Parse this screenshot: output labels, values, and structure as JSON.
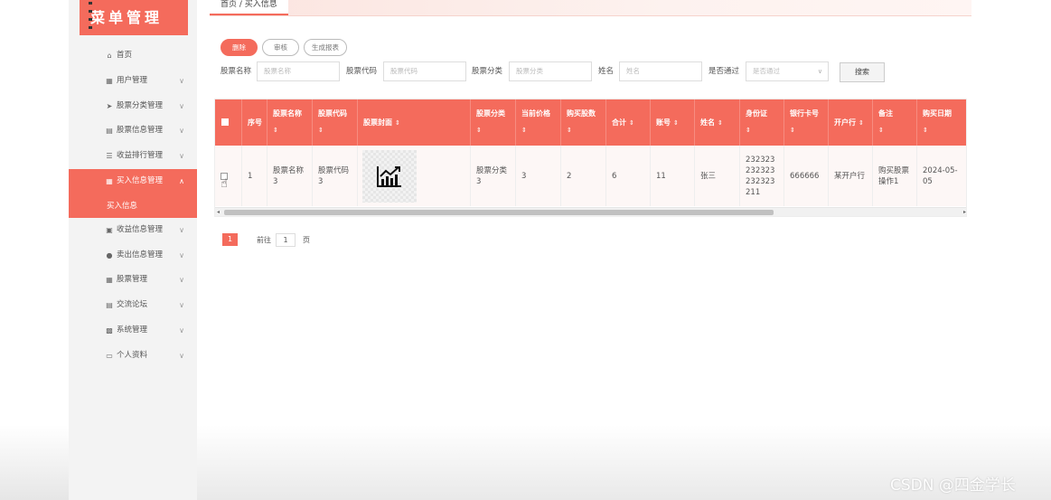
{
  "app": {
    "logo_text": "菜单管理",
    "watermark": "CSDN @四金学长"
  },
  "colors": {
    "accent": "#f46b5c",
    "sidebar_bg": "#f3f3f3"
  },
  "sidebar": {
    "items": [
      {
        "icon": "home-icon",
        "glyph": "⌂",
        "label": "首页",
        "chevron": false
      },
      {
        "icon": "grid-icon",
        "glyph": "▦",
        "label": "用户管理",
        "chevron": true
      },
      {
        "icon": "send-icon",
        "glyph": "➤",
        "label": "股票分类管理",
        "chevron": true
      },
      {
        "icon": "document-icon",
        "glyph": "▤",
        "label": "股票信息管理",
        "chevron": true
      },
      {
        "icon": "list-icon",
        "glyph": "☰",
        "label": "收益排行管理",
        "chevron": true
      },
      {
        "icon": "grid-icon",
        "glyph": "▦",
        "label": "买入信息管理",
        "chevron": true,
        "active": true,
        "sub": "买入信息"
      },
      {
        "icon": "chart-icon",
        "glyph": "▣",
        "label": "收益信息管理",
        "chevron": true
      },
      {
        "icon": "user-icon",
        "glyph": "●",
        "label": "卖出信息管理",
        "chevron": true
      },
      {
        "icon": "grid-icon",
        "glyph": "▦",
        "label": "股票管理",
        "chevron": true
      },
      {
        "icon": "message-icon",
        "glyph": "▤",
        "label": "交流论坛",
        "chevron": true
      },
      {
        "icon": "briefcase-icon",
        "glyph": "▩",
        "label": "系统管理",
        "chevron": true
      },
      {
        "icon": "profile-icon",
        "glyph": "▭",
        "label": "个人资料",
        "chevron": true
      }
    ]
  },
  "breadcrumb": "首页 / 买入信息",
  "toolbar": {
    "delete": "删除",
    "audit": "审核",
    "report": "生成报表"
  },
  "filters": {
    "stock_name": {
      "label": "股票名称",
      "placeholder": "股票名称"
    },
    "stock_code": {
      "label": "股票代码",
      "placeholder": "股票代码"
    },
    "stock_category": {
      "label": "股票分类",
      "placeholder": "股票分类"
    },
    "name": {
      "label": "姓名",
      "placeholder": "姓名"
    },
    "approved": {
      "label": "是否通过",
      "placeholder": "是否通过"
    },
    "search_button": "搜索"
  },
  "table": {
    "headers": [
      "序号",
      "股票名称",
      "股票代码",
      "股票封面",
      "股票分类",
      "当前价格",
      "购买股数",
      "合计",
      "账号",
      "姓名",
      "身份证",
      "银行卡号",
      "开户行",
      "备注",
      "购买日期"
    ],
    "sort_glyph": "⇕",
    "row": {
      "index": "1",
      "stock_name": "股票名称3",
      "stock_code": "股票代码3",
      "category": "股票分类3",
      "price": "3",
      "shares": "2",
      "total": "6",
      "account": "11",
      "name": "张三",
      "id_card": "232323232323232323211",
      "bank_card": "666666",
      "bank": "某开户行",
      "remark": "购买股票操作1",
      "date": "2024-05-05"
    }
  },
  "pagination": {
    "current": "1",
    "goto_label": "前往",
    "goto_value": "1",
    "page_suffix": "页"
  }
}
